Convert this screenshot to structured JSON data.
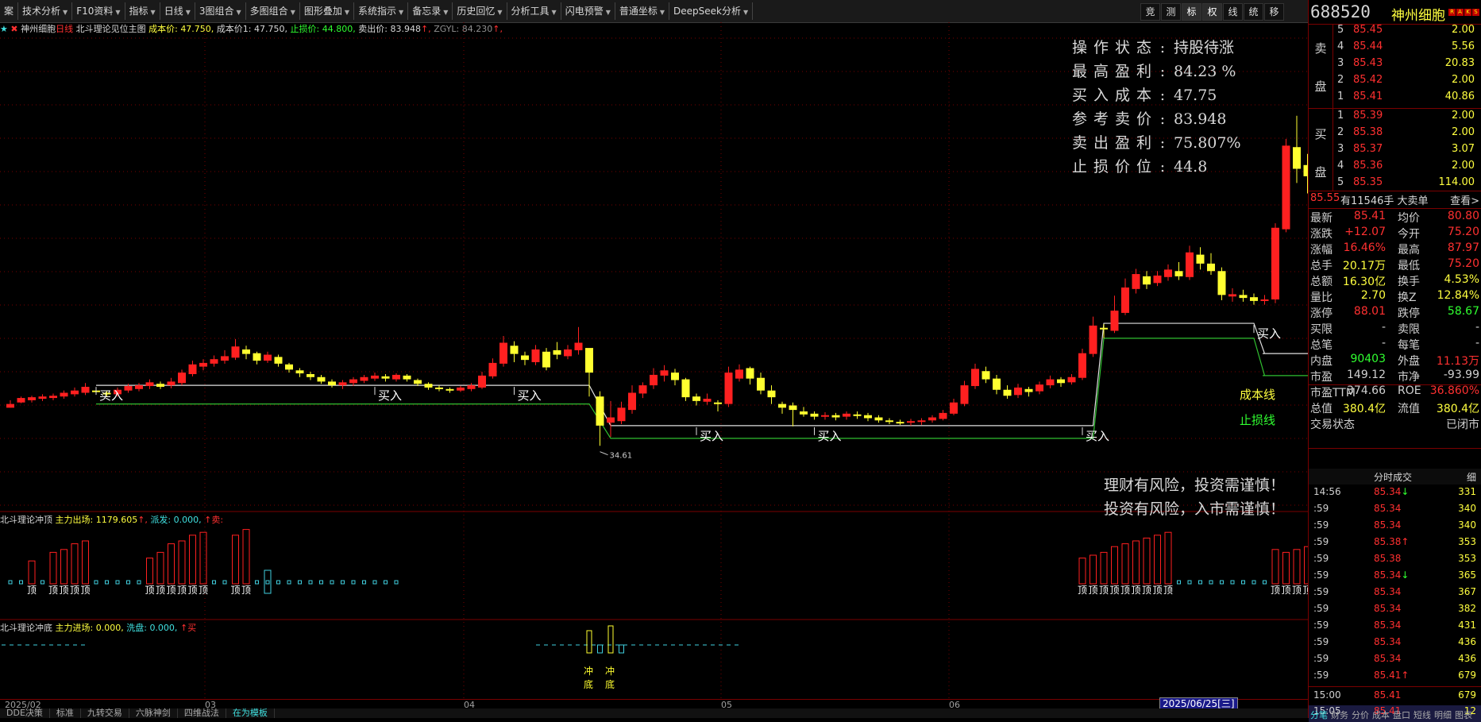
{
  "toolbar": {
    "items": [
      "案",
      "技术分析",
      "F10资料",
      "指标",
      "日线",
      "3图组合",
      "多图组合",
      "图形叠加",
      "系统指示",
      "备忘录",
      "历史回忆",
      "分析工具",
      "闪电预警",
      "普通坐标",
      "DeepSeek分析"
    ],
    "right_buttons": [
      "竞",
      "测",
      "标",
      "权",
      "线",
      "统",
      "移"
    ]
  },
  "stock": {
    "code": "688520",
    "name": "神州细胞",
    "badges": [
      "R",
      "A",
      "K",
      "S"
    ]
  },
  "legend": {
    "prefix": "★",
    "name": "神州细胞",
    "period": "日线",
    "indicator": "北斗理论见位主图",
    "cost_label": "成本价:",
    "cost_value": "47.750,",
    "cost1_label": "成本价1:",
    "cost1_value": "47.750,",
    "stop_label": "止损价:",
    "stop_value": "44.800,",
    "sell_label": "卖出价:",
    "sell_value": "83.948",
    "sell_arrow": "↑,",
    "zgyl_label": "ZGYL:",
    "zgyl_value": "84.230",
    "zgyl_arrow": "↑,"
  },
  "infobox": [
    {
      "k": "操作状态",
      "v": "持股待涨"
    },
    {
      "k": "最高盈利",
      "v": "84.23 %"
    },
    {
      "k": "买入成本",
      "v": "47.75"
    },
    {
      "k": "参考卖价",
      "v": "83.948"
    },
    {
      "k": "卖出盈利",
      "v": "75.807%"
    },
    {
      "k": "止损价位",
      "v": "44.8"
    }
  ],
  "warnings": [
    "理财有风险，投资需谨慎！",
    "投资有风险，入市需谨慎！"
  ],
  "lines": {
    "cost": "成本线",
    "stop": "止损线"
  },
  "chart_annotations": {
    "high": "87.97",
    "low": "34.61",
    "buy": "买入"
  },
  "sub1": {
    "name": "北斗理论冲顶",
    "k1": "主力出场:",
    "v1": "1179.605",
    "a1": "↑,",
    "k2": "派发:",
    "v2": "0.000,",
    "a2": "↑",
    "k3": "卖:",
    "marker": "顶"
  },
  "sub2": {
    "name": "北斗理论冲底",
    "k1": "主力进场:",
    "v1": "0.000,",
    "k2": "洗盘:",
    "v2": "0.000,",
    "a2": "↑",
    "k3": "买",
    "marker1": "冲",
    "marker2": "底"
  },
  "time_axis": [
    "2025/02",
    "03",
    "04",
    "05",
    "06"
  ],
  "current_date": "2025/06/25[三]",
  "bottom_tabs": [
    "DDE决策",
    "标准",
    "九转交易",
    "六脉神剑",
    "四维战法",
    "在为模板"
  ],
  "orderbook": {
    "sell_label": [
      "卖",
      "盘"
    ],
    "buy_label": [
      "买",
      "盘"
    ],
    "sell": [
      {
        "n": "5",
        "p": "85.45",
        "v": "2.00"
      },
      {
        "n": "4",
        "p": "85.44",
        "v": "5.56"
      },
      {
        "n": "3",
        "p": "85.43",
        "v": "20.83"
      },
      {
        "n": "2",
        "p": "85.42",
        "v": "2.00"
      },
      {
        "n": "1",
        "p": "85.41",
        "v": "40.86"
      }
    ],
    "buy": [
      {
        "n": "1",
        "p": "85.39",
        "v": "2.00"
      },
      {
        "n": "2",
        "p": "85.38",
        "v": "2.00"
      },
      {
        "n": "3",
        "p": "85.37",
        "v": "3.07"
      },
      {
        "n": "4",
        "p": "85.36",
        "v": "2.00"
      },
      {
        "n": "5",
        "p": "85.35",
        "v": "114.00"
      }
    ]
  },
  "bigorder": {
    "price": "85.55",
    "text": "有11546手 大卖单",
    "link": "查看>"
  },
  "quotes": [
    {
      "k1": "最新",
      "v1": "85.41",
      "c1": "#ff3030",
      "k2": "均价",
      "v2": "80.80",
      "c2": "#ff3030"
    },
    {
      "k1": "涨跌",
      "v1": "+12.07",
      "c1": "#ff3030",
      "k2": "今开",
      "v2": "75.20",
      "c2": "#ff3030"
    },
    {
      "k1": "涨幅",
      "v1": "16.46%",
      "c1": "#ff3030",
      "k2": "最高",
      "v2": "87.97",
      "c2": "#ff3030"
    },
    {
      "k1": "总手",
      "v1": "20.17万",
      "c1": "#ffff3f",
      "k2": "最低",
      "v2": "75.20",
      "c2": "#ff3030"
    },
    {
      "k1": "总额",
      "v1": "16.30亿",
      "c1": "#ffff3f",
      "k2": "换手",
      "v2": "4.53%",
      "c2": "#ffff3f"
    },
    {
      "k1": "量比",
      "v1": "2.70",
      "c1": "#ffff3f",
      "k2": "换Z",
      "v2": "12.84%",
      "c2": "#ffff3f"
    },
    {
      "k1": "涨停",
      "v1": "88.01",
      "c1": "#ff3030",
      "k2": "跌停",
      "v2": "58.67",
      "c2": "#30ff30"
    },
    {
      "k1": "买限",
      "v1": "-",
      "c1": "#d0d0d0",
      "k2": "卖限",
      "v2": "-",
      "c2": "#d0d0d0"
    },
    {
      "k1": "总笔",
      "v1": "-",
      "c1": "#d0d0d0",
      "k2": "每笔",
      "v2": "-",
      "c2": "#d0d0d0"
    },
    {
      "k1": "内盘",
      "v1": "90403",
      "c1": "#30ff30",
      "k2": "外盘",
      "v2": "11.13万",
      "c2": "#ff3030"
    },
    {
      "k1": "市盈",
      "v1": "149.12",
      "c1": "#d0d0d0",
      "k2": "市净",
      "v2": "-93.99",
      "c2": "#d0d0d0"
    },
    {
      "k1": "市盈TTM",
      "v1": "374.66",
      "c1": "#d0d0d0",
      "k2": "ROE",
      "v2": "36.860%",
      "c2": "#ff3030"
    },
    {
      "k1": "总值",
      "v1": "380.4亿",
      "c1": "#ffff3f",
      "k2": "流值",
      "v2": "380.4亿",
      "c2": "#ffff3f"
    },
    {
      "k1": "交易状态",
      "v1": "",
      "c1": "#d0d0d0",
      "k2": "",
      "v2": "已闭市",
      "c2": "#d0d0d0"
    }
  ],
  "ticks_header": {
    "title": "分时成交",
    "right": "细"
  },
  "ticks": [
    {
      "t": "14:56",
      "p": "85.34",
      "a": "↓",
      "v": "331",
      "c": "#ff3030",
      "ac": "#30ff30"
    },
    {
      "t": ":59",
      "p": "85.34",
      "a": "",
      "v": "340",
      "c": "#ff3030",
      "ac": ""
    },
    {
      "t": ":59",
      "p": "85.34",
      "a": "",
      "v": "340",
      "c": "#ff3030",
      "ac": ""
    },
    {
      "t": ":59",
      "p": "85.38",
      "a": "↑",
      "v": "353",
      "c": "#ff3030",
      "ac": "#ff3030"
    },
    {
      "t": ":59",
      "p": "85.38",
      "a": "",
      "v": "353",
      "c": "#ff3030",
      "ac": ""
    },
    {
      "t": ":59",
      "p": "85.34",
      "a": "↓",
      "v": "365",
      "c": "#ff3030",
      "ac": "#30ff30"
    },
    {
      "t": ":59",
      "p": "85.34",
      "a": "",
      "v": "367",
      "c": "#ff3030",
      "ac": ""
    },
    {
      "t": ":59",
      "p": "85.34",
      "a": "",
      "v": "382",
      "c": "#ff3030",
      "ac": ""
    },
    {
      "t": ":59",
      "p": "85.34",
      "a": "",
      "v": "431",
      "c": "#ff3030",
      "ac": ""
    },
    {
      "t": ":59",
      "p": "85.34",
      "a": "",
      "v": "436",
      "c": "#ff3030",
      "ac": ""
    },
    {
      "t": ":59",
      "p": "85.34",
      "a": "",
      "v": "436",
      "c": "#ff3030",
      "ac": ""
    },
    {
      "t": ":59",
      "p": "85.41",
      "a": "↑",
      "v": "679",
      "c": "#ff3030",
      "ac": "#ff3030"
    },
    {
      "t": "15:00",
      "p": "85.41",
      "a": "",
      "v": "679",
      "c": "#ff3030",
      "ac": ""
    },
    {
      "t": "15:05",
      "p": "85.41",
      "a": "",
      "v": "12",
      "c": "#ff3030",
      "ac": ""
    }
  ],
  "right_tabs": [
    "分笔",
    "财务",
    "分价",
    "成本",
    "盘口",
    "短线",
    "明细",
    "图表"
  ],
  "chart_data": {
    "type": "candlestick",
    "ylim": [
      30,
      90
    ],
    "cost_price": 47.75,
    "stop_price": 44.8,
    "high_annotation": 87.97,
    "low_annotation": 34.61,
    "candles": [
      [
        40.5,
        41.0,
        40.5,
        41.5
      ],
      [
        41.2,
        41.8,
        41.1,
        42.0
      ],
      [
        41.5,
        41.9,
        41.2,
        42.1
      ],
      [
        41.7,
        42.0,
        41.4,
        42.3
      ],
      [
        41.8,
        42.1,
        41.5,
        42.4
      ],
      [
        42.0,
        42.5,
        41.7,
        42.8
      ],
      [
        42.3,
        42.8,
        42.0,
        43.2
      ],
      [
        42.5,
        43.3,
        42.2,
        43.8
      ],
      [
        42.8,
        42.6,
        42.3,
        43.0
      ],
      [
        42.5,
        42.3,
        42.0,
        42.8
      ],
      [
        42.3,
        42.9,
        42.0,
        43.2
      ],
      [
        42.8,
        43.4,
        42.5,
        43.7
      ],
      [
        43.0,
        43.5,
        42.7,
        43.8
      ],
      [
        43.4,
        43.9,
        43.0,
        44.3
      ],
      [
        43.7,
        43.3,
        43.0,
        44.0
      ],
      [
        43.5,
        44.0,
        43.1,
        44.5
      ],
      [
        43.8,
        45.2,
        43.5,
        45.6
      ],
      [
        45.0,
        46.3,
        44.7,
        46.8
      ],
      [
        46.0,
        46.5,
        45.5,
        47.0
      ],
      [
        46.4,
        47.0,
        46.0,
        47.5
      ],
      [
        46.8,
        47.4,
        46.4,
        48.2
      ],
      [
        47.2,
        48.7,
        46.9,
        49.7
      ],
      [
        48.3,
        47.7,
        47.0,
        48.8
      ],
      [
        47.8,
        46.8,
        46.3,
        48.0
      ],
      [
        46.8,
        47.6,
        46.5,
        48.0
      ],
      [
        47.3,
        46.4,
        46.0,
        47.6
      ],
      [
        46.3,
        45.6,
        45.2,
        46.5
      ],
      [
        45.5,
        45.1,
        44.6,
        45.8
      ],
      [
        45.0,
        44.6,
        44.2,
        45.3
      ],
      [
        44.6,
        44.0,
        43.7,
        44.9
      ],
      [
        44.0,
        43.5,
        43.2,
        44.3
      ],
      [
        43.5,
        43.9,
        43.0,
        44.2
      ],
      [
        43.8,
        44.3,
        43.4,
        44.6
      ],
      [
        44.1,
        44.6,
        43.8,
        44.9
      ],
      [
        44.4,
        44.8,
        44.1,
        45.2
      ],
      [
        44.7,
        44.4,
        44.0,
        45.0
      ],
      [
        44.3,
        44.9,
        44.0,
        45.1
      ],
      [
        44.8,
        44.3,
        44.0,
        45.0
      ],
      [
        44.2,
        43.7,
        43.4,
        44.4
      ],
      [
        43.7,
        43.2,
        42.9,
        43.9
      ],
      [
        43.2,
        43.0,
        42.7,
        43.5
      ],
      [
        43.0,
        42.8,
        42.5,
        43.2
      ],
      [
        42.8,
        43.2,
        42.6,
        43.4
      ],
      [
        43.0,
        43.5,
        42.7,
        43.8
      ],
      [
        43.2,
        44.8,
        43.0,
        45.3
      ],
      [
        44.7,
        46.5,
        44.4,
        47.1
      ],
      [
        46.4,
        49.2,
        46.0,
        50.1
      ],
      [
        48.8,
        47.7,
        46.6,
        49.4
      ],
      [
        47.5,
        46.9,
        46.2,
        48.0
      ],
      [
        46.6,
        48.3,
        46.2,
        48.9
      ],
      [
        48.0,
        45.9,
        45.5,
        48.5
      ],
      [
        48.2,
        47.6,
        47.0,
        49.3
      ],
      [
        47.4,
        48.3,
        47.0,
        48.9
      ],
      [
        48.2,
        49.2,
        47.6,
        51.3
      ],
      [
        48.5,
        45.2,
        42.0,
        45.9
      ],
      [
        42.0,
        38.1,
        35.4,
        42.7
      ],
      [
        38.5,
        39.2,
        36.6,
        41.4
      ],
      [
        38.7,
        40.5,
        38.3,
        41.3
      ],
      [
        40.2,
        42.5,
        39.7,
        43.5
      ],
      [
        42.4,
        43.5,
        41.8,
        43.9
      ],
      [
        43.5,
        44.9,
        43.0,
        45.8
      ],
      [
        44.8,
        45.5,
        44.0,
        46.2
      ],
      [
        45.2,
        44.2,
        43.5,
        45.7
      ],
      [
        44.3,
        41.9,
        41.4,
        44.5
      ],
      [
        42.0,
        41.4,
        40.8,
        42.4
      ],
      [
        41.3,
        41.7,
        40.9,
        42.4
      ],
      [
        41.2,
        41.0,
        40.0,
        41.5
      ],
      [
        41.0,
        45.2,
        40.6,
        46.0
      ],
      [
        44.4,
        45.6,
        44.0,
        46.3
      ],
      [
        45.8,
        44.4,
        43.6,
        46.0
      ],
      [
        44.5,
        42.8,
        42.3,
        45.2
      ],
      [
        42.8,
        41.9,
        41.0,
        43.5
      ],
      [
        41.0,
        40.5,
        39.7,
        41.3
      ],
      [
        40.8,
        40.2,
        38.0,
        41.2
      ],
      [
        40.0,
        39.6,
        39.3,
        40.6
      ],
      [
        39.7,
        39.3,
        38.9,
        40.0
      ],
      [
        39.3,
        39.5,
        38.9,
        39.9
      ],
      [
        39.5,
        39.2,
        38.8,
        39.8
      ],
      [
        39.3,
        39.7,
        38.9,
        40.0
      ],
      [
        39.6,
        39.4,
        39.0,
        40.0
      ],
      [
        39.5,
        39.1,
        38.7,
        39.8
      ],
      [
        39.2,
        38.8,
        38.5,
        39.5
      ],
      [
        38.8,
        38.6,
        38.3,
        39.1
      ],
      [
        38.6,
        38.5,
        38.2,
        38.9
      ],
      [
        38.5,
        38.7,
        38.1,
        39.0
      ],
      [
        38.6,
        38.8,
        38.2,
        39.1
      ],
      [
        38.8,
        39.2,
        38.5,
        39.5
      ],
      [
        39.0,
        39.8,
        38.8,
        40.2
      ],
      [
        39.7,
        41.2,
        39.5,
        41.7
      ],
      [
        41.0,
        43.5,
        40.7,
        44.1
      ],
      [
        43.4,
        45.7,
        43.0,
        46.4
      ],
      [
        45.4,
        44.3,
        43.8,
        46.0
      ],
      [
        44.4,
        42.9,
        42.3,
        44.9
      ],
      [
        42.9,
        42.1,
        41.7,
        43.5
      ],
      [
        42.2,
        43.2,
        41.8,
        43.7
      ],
      [
        43.0,
        42.6,
        42.0,
        43.3
      ],
      [
        42.7,
        43.6,
        42.3,
        44.0
      ],
      [
        43.5,
        44.3,
        43.1,
        44.8
      ],
      [
        44.3,
        43.8,
        43.3,
        44.6
      ],
      [
        43.9,
        44.6,
        43.6,
        45.0
      ],
      [
        44.5,
        47.8,
        44.2,
        48.4
      ],
      [
        47.7,
        51.5,
        47.3,
        52.7
      ],
      [
        51.2,
        51.0,
        49.8,
        51.7
      ],
      [
        50.8,
        53.5,
        50.5,
        55.5
      ],
      [
        53.2,
        56.6,
        52.9,
        57.8
      ],
      [
        56.4,
        58.4,
        55.8,
        59.1
      ],
      [
        58.1,
        57.0,
        56.4,
        58.8
      ],
      [
        57.2,
        58.2,
        56.8,
        58.8
      ],
      [
        58.0,
        59.0,
        57.5,
        59.7
      ],
      [
        58.8,
        58.1,
        57.6,
        60.0
      ],
      [
        58.0,
        61.3,
        57.6,
        62.2
      ],
      [
        61.0,
        59.8,
        59.0,
        62.0
      ],
      [
        59.8,
        58.8,
        58.3,
        61.2
      ],
      [
        58.8,
        55.6,
        54.9,
        59.3
      ],
      [
        55.4,
        55.7,
        54.7,
        56.5
      ],
      [
        55.6,
        55.2,
        54.7,
        56.3
      ],
      [
        55.3,
        54.8,
        54.3,
        55.8
      ],
      [
        54.8,
        55.0,
        54.3,
        55.6
      ],
      [
        55.0,
        64.6,
        54.5,
        65.2
      ],
      [
        64.4,
        75.6,
        64.0,
        76.5
      ],
      [
        75.4,
        72.5,
        70.6,
        79.6
      ],
      [
        73.0,
        71.5,
        69.2,
        74.5
      ],
      [
        71.6,
        73.5,
        69.7,
        75.0
      ],
      [
        73.2,
        74.7,
        72.8,
        76.0
      ],
      [
        74.6,
        75.5,
        74.0,
        76.7
      ],
      [
        75.4,
        77.6,
        75.0,
        78.8
      ],
      [
        77.5,
        80.5,
        76.8,
        82.9
      ],
      [
        80.2,
        79.5,
        78.5,
        82.9
      ],
      [
        79.2,
        82.4,
        78.8,
        83.0
      ],
      [
        82.2,
        85.4,
        81.7,
        85.8
      ],
      [
        75.2,
        85.41,
        75.2,
        87.97
      ]
    ],
    "buy_signals": [
      8,
      34,
      47,
      64,
      75,
      100,
      116
    ],
    "sub1_bars": [
      {
        "i": 2,
        "v": 0.4
      },
      {
        "i": 4,
        "v": 0.55
      },
      {
        "i": 5,
        "v": 0.6
      },
      {
        "i": 6,
        "v": 0.7
      },
      {
        "i": 7,
        "v": 0.75
      },
      {
        "i": 13,
        "v": 0.45
      },
      {
        "i": 14,
        "v": 0.55
      },
      {
        "i": 15,
        "v": 0.7
      },
      {
        "i": 16,
        "v": 0.75
      },
      {
        "i": 17,
        "v": 0.85
      },
      {
        "i": 18,
        "v": 0.9
      },
      {
        "i": 21,
        "v": 0.85
      },
      {
        "i": 22,
        "v": 0.95
      },
      {
        "i": 100,
        "v": 0.45
      },
      {
        "i": 101,
        "v": 0.5
      },
      {
        "i": 102,
        "v": 0.55
      },
      {
        "i": 103,
        "v": 0.65
      },
      {
        "i": 104,
        "v": 0.7
      },
      {
        "i": 105,
        "v": 0.75
      },
      {
        "i": 106,
        "v": 0.8
      },
      {
        "i": 107,
        "v": 0.85
      },
      {
        "i": 108,
        "v": 0.9
      },
      {
        "i": 118,
        "v": 0.6
      },
      {
        "i": 119,
        "v": 0.55
      },
      {
        "i": 120,
        "v": 0.6
      },
      {
        "i": 121,
        "v": 0.65
      },
      {
        "i": 122,
        "v": 0.7
      },
      {
        "i": 123,
        "v": 0.75
      },
      {
        "i": 124,
        "v": 0.8
      },
      {
        "i": 125,
        "v": 0.85
      },
      {
        "i": 126,
        "v": 0.9
      },
      {
        "i": 127,
        "v": 0.95
      }
    ],
    "sub2_bars": [
      {
        "i": 54,
        "v": 0.7
      },
      {
        "i": 55,
        "v": 0.25
      },
      {
        "i": 56,
        "v": 0.85
      },
      {
        "i": 57,
        "v": 0.25
      }
    ]
  }
}
